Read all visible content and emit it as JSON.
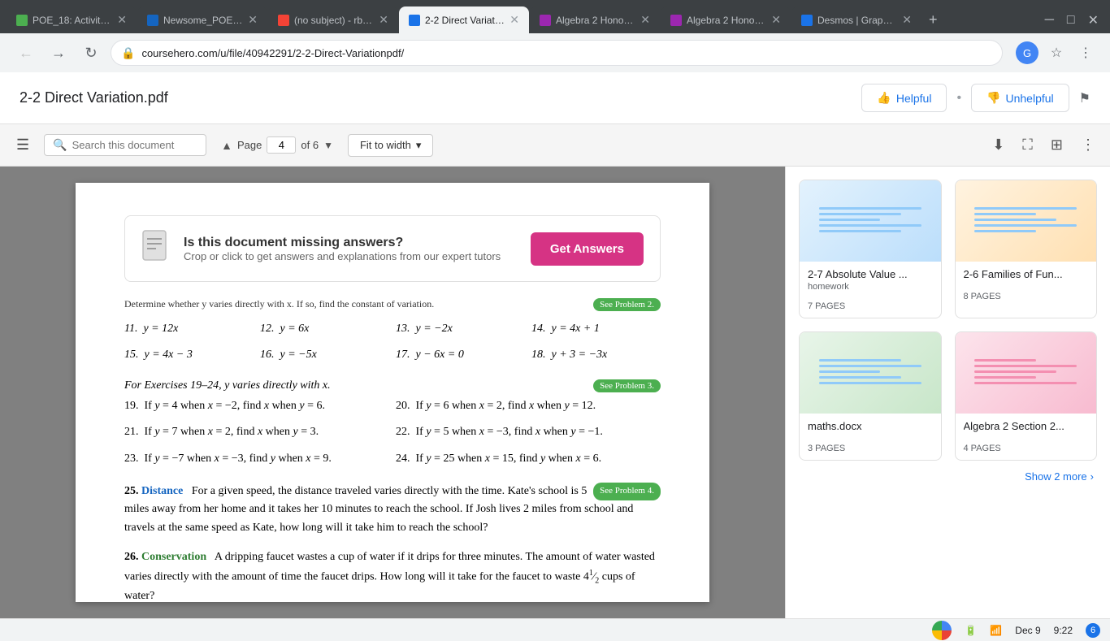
{
  "browser": {
    "tabs": [
      {
        "id": "tab1",
        "favicon_color": "#4caf50",
        "title": "POE_18: Activity 3...",
        "active": false
      },
      {
        "id": "tab2",
        "favicon_color": "#1565c0",
        "title": "Newsome_POE_C...",
        "active": false
      },
      {
        "id": "tab3",
        "favicon_color": "#f44336",
        "title": "(no subject) - rbne...",
        "active": false
      },
      {
        "id": "tab4",
        "favicon_color": "#1a73e8",
        "title": "2-2 Direct Variatio...",
        "active": true
      },
      {
        "id": "tab5",
        "favicon_color": "#9c27b0",
        "title": "Algebra 2 Honors...",
        "active": false
      },
      {
        "id": "tab6",
        "favicon_color": "#9c27b0",
        "title": "Algebra 2 Honors...",
        "active": false
      },
      {
        "id": "tab7",
        "favicon_color": "#1a73e8",
        "title": "Desmos | Graphin...",
        "active": false
      }
    ],
    "url": "coursehero.com/u/file/40942291/2-2-Direct-Variationpdf/",
    "url_full": "coursehero.com/u/file/40942291/2-2-Direct-Variationpdf/"
  },
  "header": {
    "title": "2-2 Direct Variation.pdf",
    "helpful_label": "Helpful",
    "unhelpful_label": "Unhelpful",
    "flag_icon": "⚑"
  },
  "pdf_toolbar": {
    "search_placeholder": "Search this document",
    "page_label": "Page",
    "page_current": "4",
    "page_total": "of 6",
    "fit_width_label": "Fit to width",
    "download_icon": "⬇",
    "fullscreen_icon": "⛶",
    "toggle_icon": "⊞",
    "more_icon": "⋮"
  },
  "answer_banner": {
    "title": "Is this document missing answers?",
    "subtitle": "Crop or click to get answers and explanations from our expert tutors",
    "btn_label": "Get Answers"
  },
  "pdf_content": {
    "header_line": "Determine whether y varies directly with x. If so, find the constant of variation.",
    "see_problem_2": "See Problem 2.",
    "exercises_11_to_18": [
      {
        "num": "11.",
        "eq": "y = 12x"
      },
      {
        "num": "12.",
        "eq": "y = 6x"
      },
      {
        "num": "13.",
        "eq": "y = −2x"
      },
      {
        "num": "14.",
        "eq": "y = 4x + 1"
      },
      {
        "num": "15.",
        "eq": "y = 4x − 3"
      },
      {
        "num": "16.",
        "eq": "y = −5x"
      },
      {
        "num": "17.",
        "eq": "y − 6x = 0"
      },
      {
        "num": "18.",
        "eq": "y + 3 = −3x"
      }
    ],
    "section_19_24_header": "For Exercises 19–24, y varies directly with x.",
    "see_problem_3": "See Problem 3.",
    "exercises_19_24": [
      {
        "num": "19.",
        "text": "If y = 4 when x = −2, find x when y = 6."
      },
      {
        "num": "20.",
        "text": "If y = 6 when x = 2, find x when y = 12."
      },
      {
        "num": "21.",
        "text": "If y = 7 when x = 2, find x when y = 3."
      },
      {
        "num": "22.",
        "text": "If y = 5 when x = −3, find x when y = −1."
      },
      {
        "num": "23.",
        "text": "If y = −7 when x = −3, find y when x = 9."
      },
      {
        "num": "24.",
        "text": "If y = 25 when x = 15, find y when x = 6."
      }
    ],
    "word_problem_25_label": "Distance",
    "word_problem_25_see": "See Problem 4.",
    "word_problem_25_text": "For a given speed, the distance traveled varies directly with the time. Kate's school is 5 miles away from her home and it takes her 10 minutes to reach the school. If Josh lives 2 miles from school and travels at the same speed as Kate, how long will it take him to reach the school?",
    "word_problem_26_label": "Conservation",
    "word_problem_26_text": "A dripping faucet wastes a cup of water if it drips for three minutes. The amount of water wasted varies directly with the amount of time the faucet drips. How long will it take for the faucet to waste 4½ cups of water?"
  },
  "sidebar": {
    "show_more_label": "Show 2 more",
    "doc_cards": [
      {
        "id": "card1",
        "title": "2-7 Absolute Value ...",
        "subtitle": "homework",
        "pages": "7 PAGES",
        "thumb_color": "#e3f2fd"
      },
      {
        "id": "card2",
        "title": "2-6 Families of Fun...",
        "subtitle": "",
        "pages": "8 PAGES",
        "thumb_color": "#fff3e0"
      },
      {
        "id": "card3",
        "title": "maths.docx",
        "subtitle": "",
        "pages": "3 PAGES",
        "thumb_color": "#e8f5e9"
      },
      {
        "id": "card4",
        "title": "Algebra 2 Section 2...",
        "subtitle": "",
        "pages": "4 PAGES",
        "thumb_color": "#fce4ec"
      }
    ]
  },
  "status_bar": {
    "date": "Dec 9",
    "time": "9:22",
    "battery_icon": "🔋",
    "wifi_icon": "WiFi"
  }
}
